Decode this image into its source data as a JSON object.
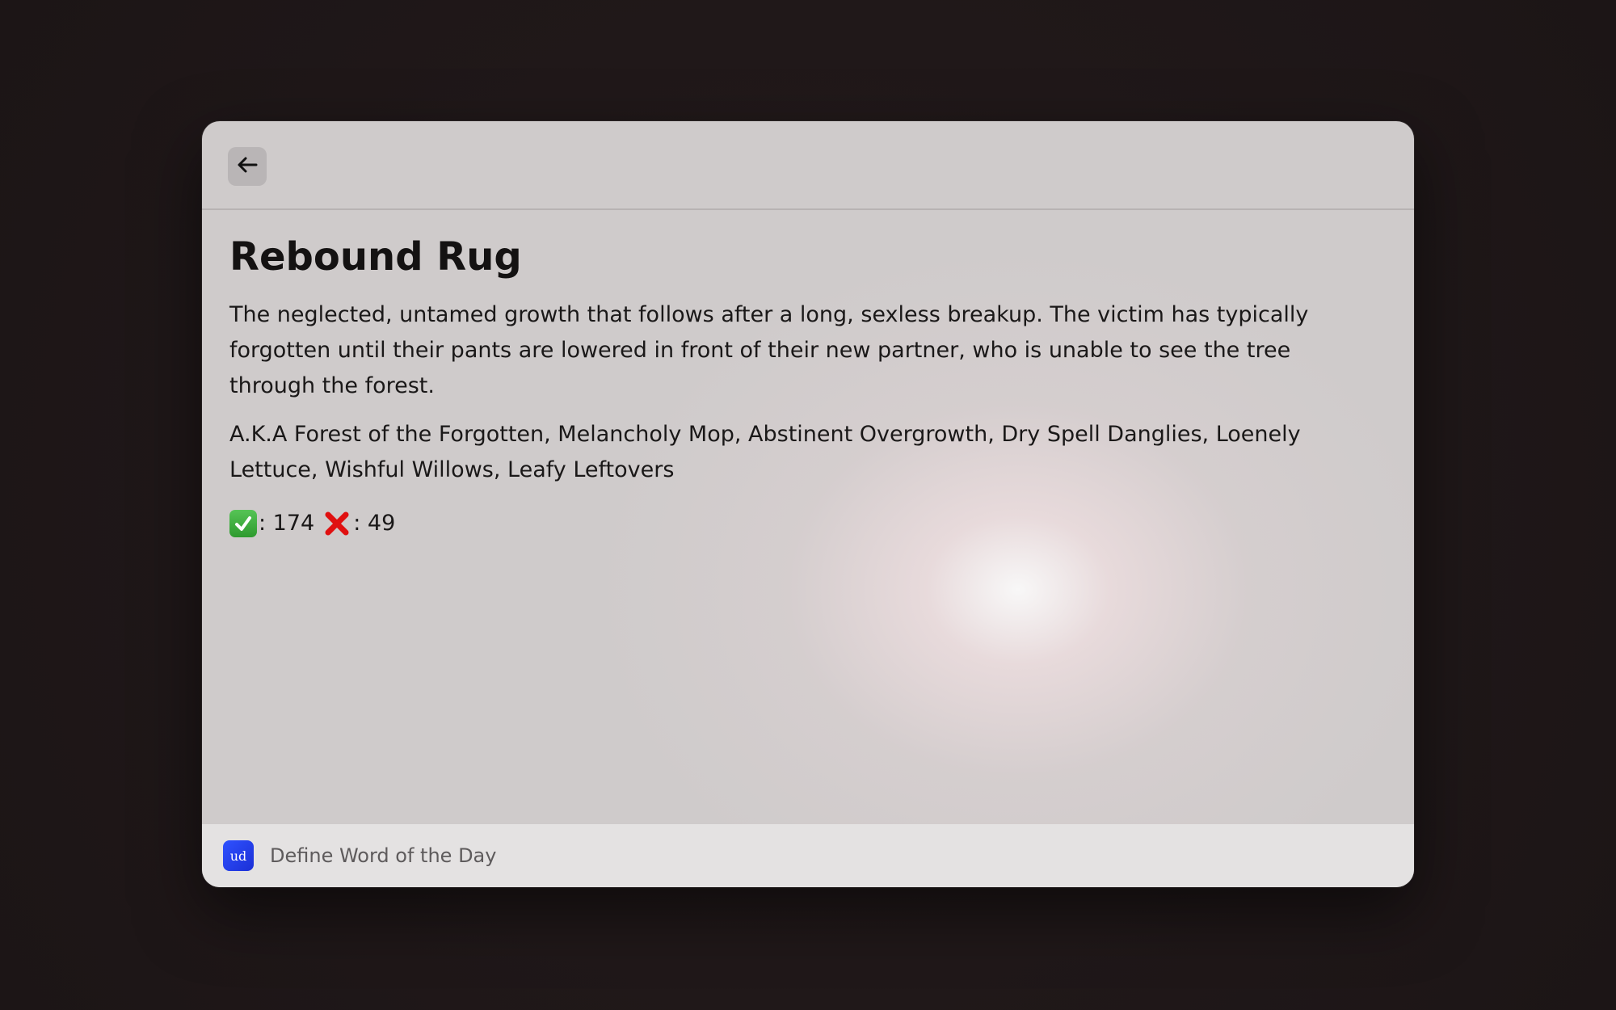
{
  "header": {
    "back_icon": "arrow-left-icon"
  },
  "entry": {
    "title": "Rebound Rug",
    "definition": "The neglected, untamed growth that follows after a long, sexless breakup. The victim has typically forgotten until their pants are lowered in front of their new partner, who is unable to see the tree through the forest.",
    "aka": "A.K.A Forest of the Forgotten, Melancholy Mop, Abstinent Overgrowth, Dry Spell Danglies, Loenely Lettuce, Wishful Willows, Leafy Leftovers",
    "votes": {
      "up_icon": "check-mark-icon",
      "up_label": ": 174",
      "down_icon": "cross-mark-icon",
      "down_label": ": 49"
    }
  },
  "footer": {
    "app_icon_text": "ud",
    "action_label": "Define Word of the Day"
  }
}
